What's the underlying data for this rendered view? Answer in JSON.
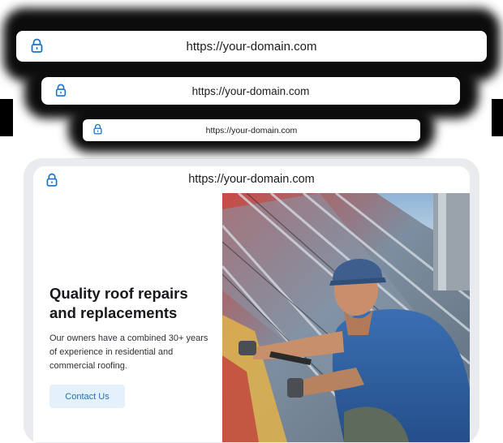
{
  "url_bars": [
    {
      "url": "https://your-domain.com"
    },
    {
      "url": "https://your-domain.com"
    },
    {
      "url": "https://your-domain.com"
    }
  ],
  "preview": {
    "url": "https://your-domain.com",
    "headline": "Quality roof repairs and replacements",
    "description": "Our owners have a combined 30+ years of experience in residential and commercial roofing.",
    "cta_label": "Contact Us"
  },
  "colors": {
    "lock_icon": "#1a73c9",
    "cta_background": "#e4f1fb",
    "cta_text": "#1d6fbf",
    "headline": "#16181d"
  },
  "icons": {
    "lock": "lock-icon"
  },
  "image": {
    "subject": "roofer-photo"
  }
}
